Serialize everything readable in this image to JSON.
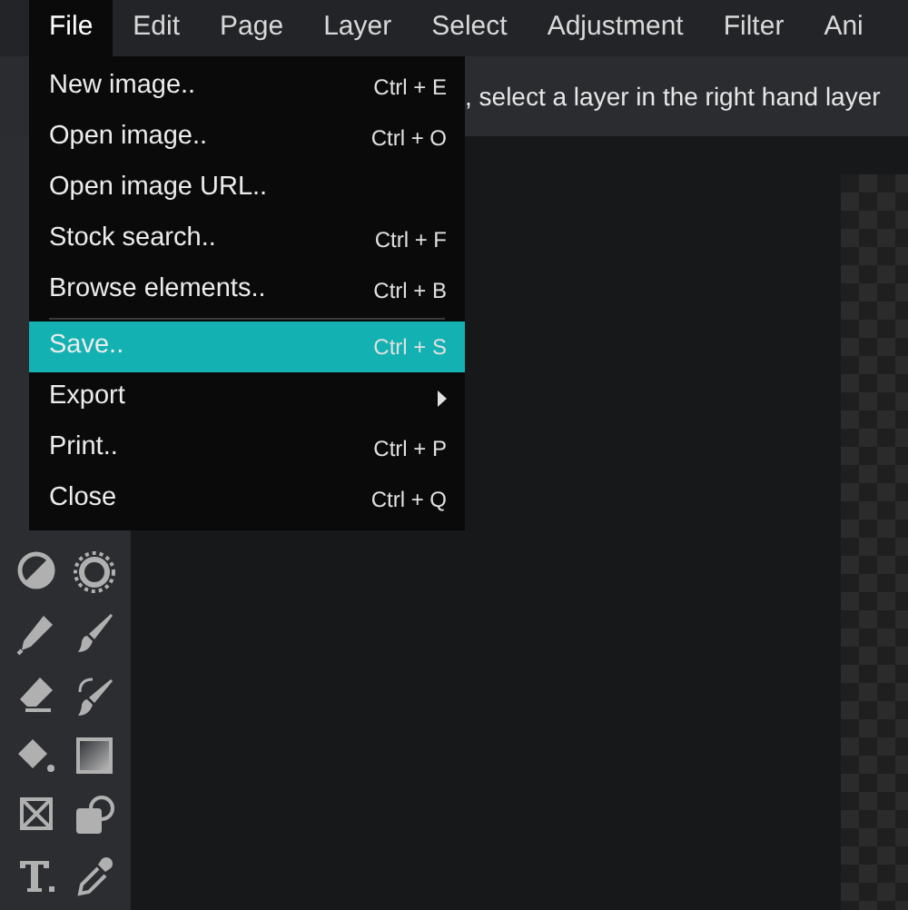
{
  "menubar": [
    {
      "label": "File",
      "selected": true
    },
    {
      "label": "Edit",
      "selected": false
    },
    {
      "label": "Page",
      "selected": false
    },
    {
      "label": "Layer",
      "selected": false
    },
    {
      "label": "Select",
      "selected": false
    },
    {
      "label": "Adjustment",
      "selected": false
    },
    {
      "label": "Filter",
      "selected": false
    },
    {
      "label": "Ani",
      "selected": false
    }
  ],
  "file_menu": [
    {
      "kind": "item",
      "label": "New image..",
      "shortcut": "Ctrl + E",
      "selected": false
    },
    {
      "kind": "item",
      "label": "Open image..",
      "shortcut": "Ctrl + O",
      "selected": false
    },
    {
      "kind": "item",
      "label": "Open image URL..",
      "selected": false
    },
    {
      "kind": "item",
      "label": "Stock search..",
      "shortcut": "Ctrl + F",
      "selected": false
    },
    {
      "kind": "item",
      "label": "Browse elements..",
      "shortcut": "Ctrl + B",
      "selected": false
    },
    {
      "kind": "separator"
    },
    {
      "kind": "item",
      "label": "Save..",
      "shortcut": "Ctrl + S",
      "selected": true
    },
    {
      "kind": "submenu",
      "label": "Export",
      "selected": false
    },
    {
      "kind": "item",
      "label": "Print..",
      "shortcut": "Ctrl + P",
      "selected": false
    },
    {
      "kind": "item",
      "label": "Close",
      "shortcut": "Ctrl + Q",
      "selected": false
    }
  ],
  "options_bar": {
    "hint": ", select a layer in the right hand layer"
  }
}
